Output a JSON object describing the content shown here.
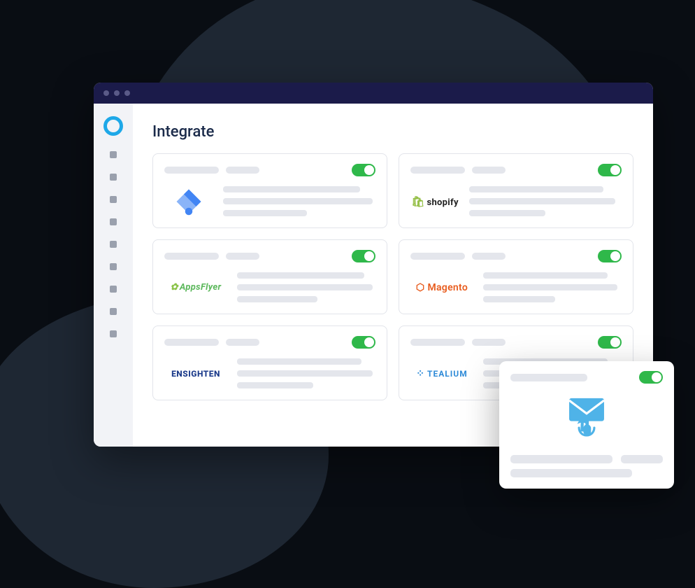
{
  "page": {
    "title": "Integrate"
  },
  "integrations": [
    {
      "id": "google-tag-manager",
      "label": "Google Tag Manager",
      "enabled": true
    },
    {
      "id": "shopify",
      "label": "shopify",
      "enabled": true
    },
    {
      "id": "appsflyer",
      "label": "AppsFlyer",
      "enabled": true
    },
    {
      "id": "magento",
      "label": "Magento",
      "enabled": true
    },
    {
      "id": "ensighten",
      "label": "ENSIGHTEN",
      "enabled": true
    },
    {
      "id": "tealium",
      "label": "TEALIUM",
      "enabled": true
    }
  ],
  "popup": {
    "icon": "email-click-icon",
    "enabled": true
  },
  "colors": {
    "accent": "#1ea8e8",
    "toggle_on": "#2fb84a",
    "titlebar": "#1b1b4a",
    "sidebar": "#f2f3f7",
    "placeholder": "#e4e6ec"
  }
}
